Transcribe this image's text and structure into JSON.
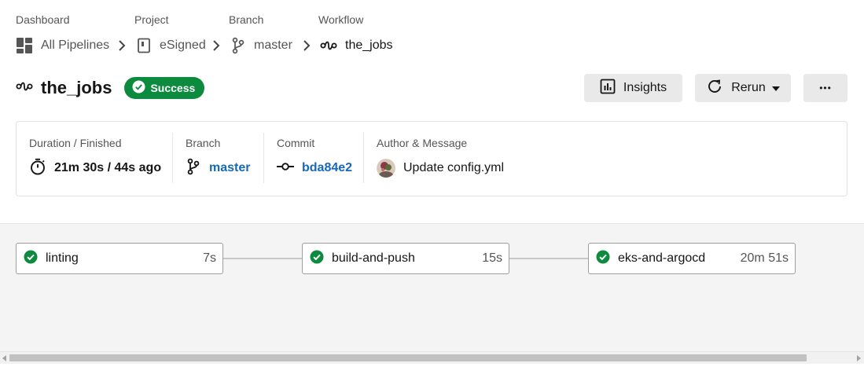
{
  "breadcrumb": {
    "labels": [
      "Dashboard",
      "Project",
      "Branch",
      "Workflow"
    ],
    "items": [
      "All Pipelines",
      "eSigned",
      "master",
      "the_jobs"
    ]
  },
  "header": {
    "title": "the_jobs",
    "status": "Success",
    "insights_label": "Insights",
    "rerun_label": "Rerun",
    "more_label": "•••"
  },
  "summary": {
    "duration_label": "Duration / Finished",
    "duration_value": "21m 30s / 44s ago",
    "branch_label": "Branch",
    "branch_value": "master",
    "commit_label": "Commit",
    "commit_value": "bda84e2",
    "author_label": "Author & Message",
    "author_message": "Update config.yml"
  },
  "jobs": [
    {
      "name": "linting",
      "duration": "7s",
      "status": "success"
    },
    {
      "name": "build-and-push",
      "duration": "15s",
      "status": "success"
    },
    {
      "name": "eks-and-argocd",
      "duration": "20m 51s",
      "status": "success"
    }
  ],
  "colors": {
    "success": "#0c8a3e",
    "link": "#1769b7"
  }
}
